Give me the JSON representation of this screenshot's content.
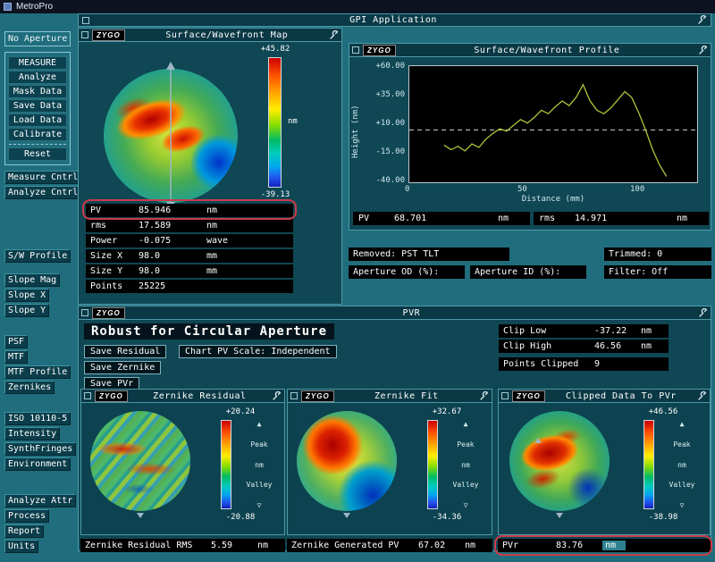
{
  "titlebar": {
    "title": "MetroPro"
  },
  "app": {
    "title": "GPI Application"
  },
  "logo": "ZYGO",
  "icons": {
    "peak_arrow": "▲",
    "valley_arrow": "▽"
  },
  "sidebar": {
    "no_aperture": "No Aperture",
    "measure_group": [
      "MEASURE",
      "Analyze",
      "Mask Data",
      "Save Data",
      "Load Data",
      "Calibrate",
      "Reset"
    ],
    "cntrl_group": [
      "Measure Cntrl",
      "Analyze Cntrl"
    ],
    "profile_btn": "S/W Profile",
    "slope_group": [
      "Slope Mag",
      "Slope X",
      "Slope Y"
    ],
    "analysis_group": [
      "PSF",
      "MTF",
      "MTF Profile",
      "Zernikes"
    ],
    "env_group": [
      "ISO 10110-5",
      "Intensity",
      "SynthFringes",
      "Environment"
    ],
    "output_group": [
      "Analyze Attr",
      "Process",
      "Report",
      "Units"
    ]
  },
  "map_window": {
    "title": "Surface/Wavefront Map",
    "scale_max": "+45.82",
    "scale_min": "-39.13",
    "scale_unit": "nm",
    "stats": [
      {
        "label": "PV",
        "value": "85.946",
        "unit": "nm"
      },
      {
        "label": "rms",
        "value": "17.589",
        "unit": "nm"
      },
      {
        "label": "Power",
        "value": "-0.075",
        "unit": "wave"
      },
      {
        "label": "Size X",
        "value": "98.0",
        "unit": "mm"
      },
      {
        "label": "Size Y",
        "value": "98.0",
        "unit": "mm"
      },
      {
        "label": "Points",
        "value": "25225",
        "unit": ""
      }
    ]
  },
  "profile_window": {
    "title": "Surface/Wavefront Profile",
    "ylabel": "Height (nm)",
    "xlabel": "Distance (mm)",
    "ytick_labels": [
      "+60.00",
      "+35.00",
      "+10.00",
      "-15.00",
      "-40.00"
    ],
    "xtick_labels": [
      "0",
      "50",
      "100"
    ],
    "pv": {
      "label": "PV",
      "value": "68.701",
      "unit": "nm"
    },
    "rms": {
      "label": "rms",
      "value": "14.971",
      "unit": "nm"
    }
  },
  "info": {
    "removed_label": "Removed:",
    "removed_value": "PST TLT",
    "trimmed_label": "Trimmed:",
    "trimmed_value": "0",
    "aperture_od": "Aperture OD (%):",
    "aperture_id": "Aperture ID (%):",
    "filter_label": "Filter:",
    "filter_value": "Off"
  },
  "pvr": {
    "title": "PVR",
    "heading": "Robust for Circular Aperture",
    "save_residual": "Save Residual",
    "chart_pv_scale": "Chart PV Scale: Independent",
    "save_zernike": "Save Zernike",
    "save_pvr": "Save PVr",
    "clip_low": {
      "label": "Clip Low",
      "value": "-37.22",
      "unit": "nm"
    },
    "clip_high": {
      "label": "Clip High",
      "value": "46.56",
      "unit": "nm"
    },
    "points_clipped": {
      "label": "Points Clipped",
      "value": "9",
      "unit": ""
    },
    "subwindows": [
      {
        "title": "Zernike Residual",
        "scale_max": "+20.24",
        "scale_min": "-20.88",
        "peak": "Peak",
        "valley": "Valley",
        "unit": "nm"
      },
      {
        "title": "Zernike Fit",
        "scale_max": "+32.67",
        "scale_min": "-34.36",
        "peak": "Peak",
        "valley": "Valley",
        "unit": "nm"
      },
      {
        "title": "Clipped Data To PVr",
        "scale_max": "+46.56",
        "scale_min": "-38.98",
        "peak": "Peak",
        "valley": "Valley",
        "unit": "nm"
      }
    ],
    "bottom_stats": [
      {
        "label": "Zernike Residual RMS",
        "value": "5.59",
        "unit": "nm"
      },
      {
        "label": "Zernike Generated PV",
        "value": "67.02",
        "unit": "nm"
      },
      {
        "label": "PVr",
        "value": "83.76",
        "unit": "nm"
      }
    ]
  },
  "chart_data": {
    "type": "line",
    "title": "Surface/Wavefront Profile",
    "xlabel": "Distance (mm)",
    "ylabel": "Height (nm)",
    "xlim": [
      0,
      125
    ],
    "ylim": [
      -40,
      60
    ],
    "xticks": [
      0,
      50,
      100
    ],
    "yticks": [
      60,
      35,
      10,
      -15,
      -40
    ],
    "reference_line_y": 5,
    "grid": false,
    "legend": [],
    "series": [
      {
        "name": "surface profile",
        "x": [
          15,
          18,
          21,
          24,
          27,
          30,
          33,
          36,
          39,
          42,
          45,
          48,
          51,
          54,
          57,
          60,
          63,
          66,
          69,
          72,
          75,
          78,
          81,
          84,
          87,
          90,
          93,
          96,
          99,
          102,
          105,
          108,
          111
        ],
        "y": [
          -8,
          -12,
          -9,
          -13,
          -7,
          -10,
          -3,
          2,
          6,
          4,
          9,
          14,
          11,
          16,
          22,
          19,
          25,
          30,
          26,
          33,
          44,
          30,
          22,
          19,
          24,
          31,
          38,
          33,
          20,
          5,
          -12,
          -25,
          -35
        ]
      }
    ]
  }
}
